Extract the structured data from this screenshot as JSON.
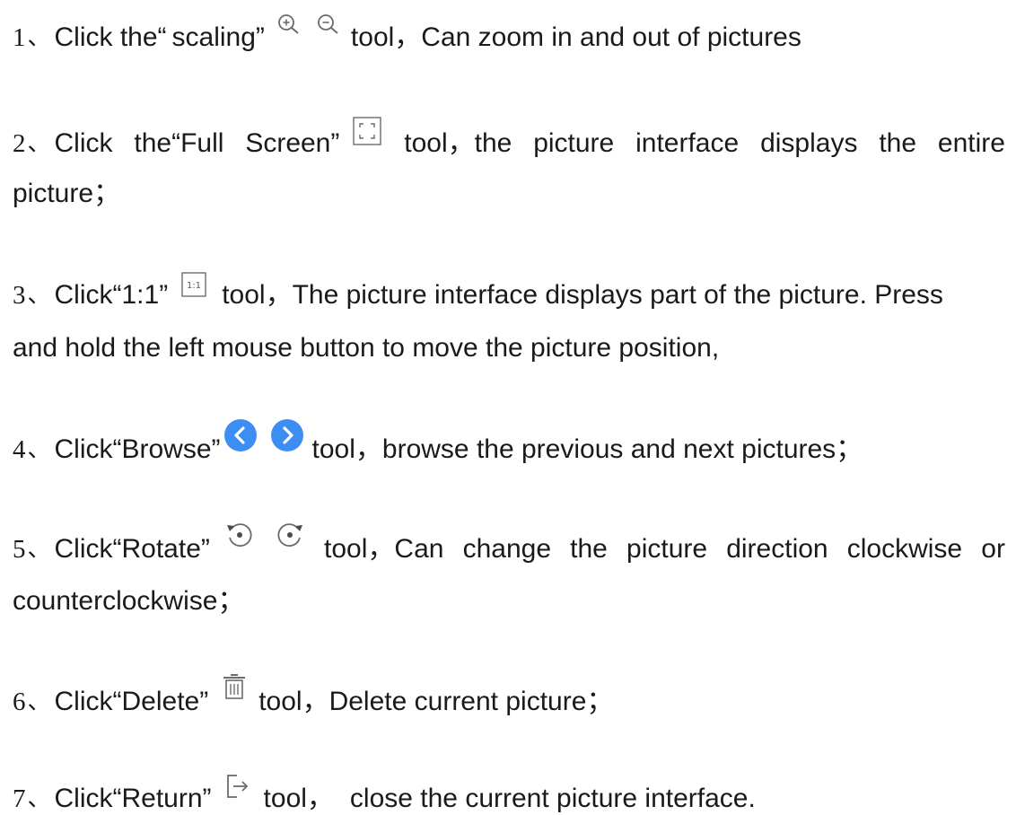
{
  "sep": "、",
  "colors": {
    "text": "#1a1a1a",
    "icon_gray": "#6b6b6b",
    "browse_blue": "#3d8ef2"
  },
  "items": [
    {
      "num": "1",
      "prefix_a": "Click the“",
      "prefix_b": "scaling”",
      "icons": [
        "zoom-in-icon",
        "zoom-out-icon"
      ],
      "suffix_a": "tool，Can zoom in and out of pictures"
    },
    {
      "num": "2",
      "words_a": [
        "Click",
        "the“Full",
        "Screen”"
      ],
      "icons": [
        "full-screen-icon"
      ],
      "words_b": [
        "tool，the",
        "picture",
        "interface",
        "displays",
        "the",
        "entire"
      ],
      "line2": "picture；"
    },
    {
      "num": "3",
      "prefix_a": "Click“1:1”",
      "icon_text": "1:1",
      "icons": [
        "one-to-one-icon"
      ],
      "suffix_a": "tool，The picture interface displays part of the picture. Press",
      "line2": "and hold the left mouse button to move the picture position,"
    },
    {
      "num": "4",
      "prefix_a": "Click“Browse”",
      "icons": [
        "previous-icon",
        "next-icon"
      ],
      "suffix_a": "tool，browse the previous and next pictures；"
    },
    {
      "num": "5",
      "prefix_a": "Click“Rotate”",
      "icons": [
        "rotate-counterclockwise-icon",
        "rotate-clockwise-icon"
      ],
      "words_b": [
        "tool，Can",
        "change",
        "the",
        "picture",
        "direction",
        "clockwise",
        "or"
      ],
      "line2": "counterclockwise；"
    },
    {
      "num": "6",
      "prefix_a": "Click“Delete”",
      "icons": [
        "delete-icon"
      ],
      "suffix_a": "tool，Delete current picture；"
    },
    {
      "num": "7",
      "prefix_a": "Click“Return”",
      "icons": [
        "return-icon"
      ],
      "suffix_a": "tool，",
      "suffix_b": "close the current picture interface."
    }
  ]
}
